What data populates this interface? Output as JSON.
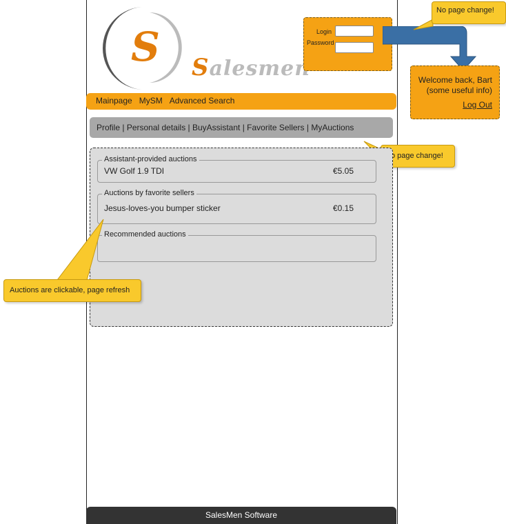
{
  "logo": {
    "letter": "S",
    "wordmark_first": "S",
    "wordmark_rest": "alesmen"
  },
  "login": {
    "login_label": "Login",
    "password_label": "Password",
    "login_value": "",
    "password_value": ""
  },
  "welcome": {
    "line1": "Welcome back, Bart",
    "line2": "(some useful info)",
    "logout": "Log Out"
  },
  "nav": {
    "items": [
      "Mainpage",
      "MySM",
      "Advanced Search"
    ]
  },
  "subnav": {
    "items": [
      "Profile",
      "Personal details",
      "BuyAssistant",
      "Favorite Sellers",
      "MyAuctions"
    ],
    "separator": " | "
  },
  "groups": [
    {
      "legend": "Assistant-provided auctions",
      "rows": [
        {
          "name": "VW Golf 1.9 TDI",
          "price": "€5.05"
        }
      ]
    },
    {
      "legend": "Auctions by favorite sellers",
      "rows": [
        {
          "name": "Jesus-loves-you bumper sticker",
          "price": "€0.15"
        }
      ]
    },
    {
      "legend": "Recommended auctions",
      "rows": []
    }
  ],
  "callouts": {
    "login_note": "No page change!",
    "subnav_note": "No page change!",
    "auctions_note": "Auctions are clickable, page refresh"
  },
  "footer": {
    "text": "SalesMen Software"
  },
  "colors": {
    "orange": "#f5a214",
    "callout": "#f9c92c",
    "arrow": "#3a6fa5",
    "footer": "#333333",
    "subnav": "#a8a8a8"
  }
}
